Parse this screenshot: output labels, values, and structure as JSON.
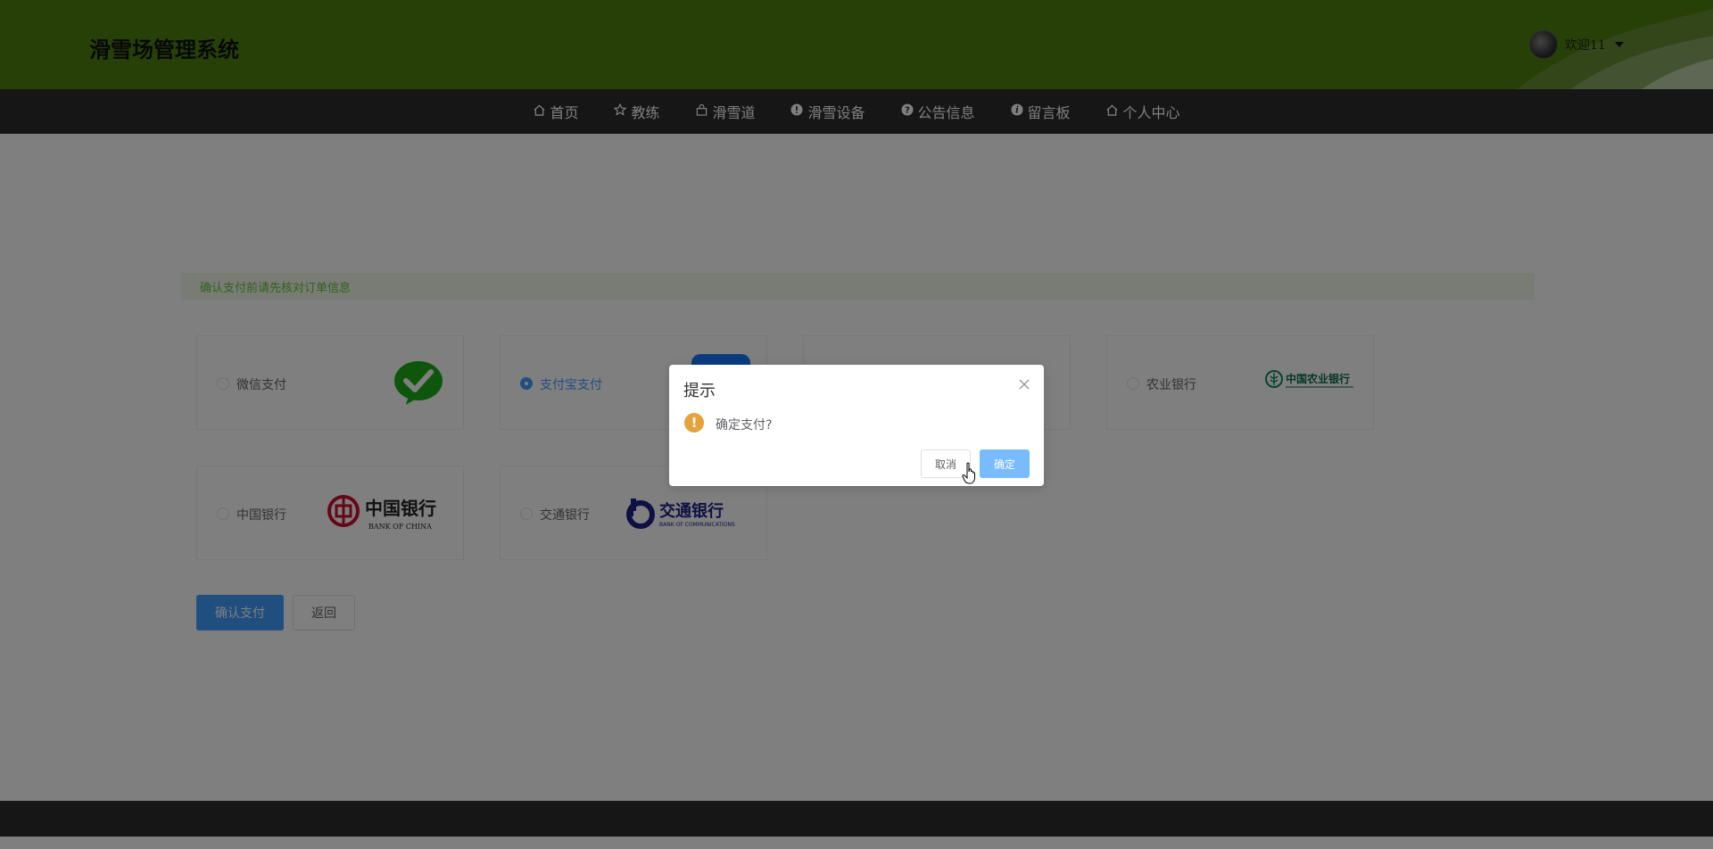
{
  "header": {
    "site_title": "滑雪场管理系统",
    "welcome_text": "欢迎11"
  },
  "nav": {
    "items": [
      {
        "label": "首页",
        "icon": "home-icon"
      },
      {
        "label": "教练",
        "icon": "star-icon"
      },
      {
        "label": "滑雪道",
        "icon": "bag-icon"
      },
      {
        "label": "滑雪设备",
        "icon": "info-icon"
      },
      {
        "label": "公告信息",
        "icon": "question-icon"
      },
      {
        "label": "留言板",
        "icon": "info-icon"
      },
      {
        "label": "个人中心",
        "icon": "home-icon"
      }
    ]
  },
  "notice": {
    "text": "确认支付前请先核对订单信息"
  },
  "payment": {
    "options": [
      {
        "label": "微信支付",
        "checked": false,
        "logo": "wechat-pay-logo"
      },
      {
        "label": "支付宝支付",
        "checked": true,
        "logo": "alipay-logo"
      },
      {
        "label": "",
        "checked": false,
        "logo": "bank-logo"
      },
      {
        "label": "农业银行",
        "checked": false,
        "logo": "agricultural-bank-logo",
        "logo_text": "中国农业银行"
      },
      {
        "label": "中国银行",
        "checked": false,
        "logo": "bank-of-china-logo",
        "logo_text": "中国银行",
        "logo_subtext": "BANK OF CHINA"
      },
      {
        "label": "交通银行",
        "checked": false,
        "logo": "bank-of-communications-logo",
        "logo_text": "交通银行",
        "logo_subtext": "BANK OF COMMUNICATIONS"
      }
    ],
    "confirm_label": "确认支付",
    "back_label": "返回"
  },
  "dialog": {
    "title": "提示",
    "message": "确定支付?",
    "cancel_label": "取消",
    "ok_label": "确定"
  },
  "colors": {
    "header_bg": "#4f800f",
    "nav_bg": "#2c2c2c",
    "primary": "#409eff",
    "warning": "#e6a23c",
    "notice_bg": "#f0f9eb",
    "notice_text": "#67c23a"
  }
}
